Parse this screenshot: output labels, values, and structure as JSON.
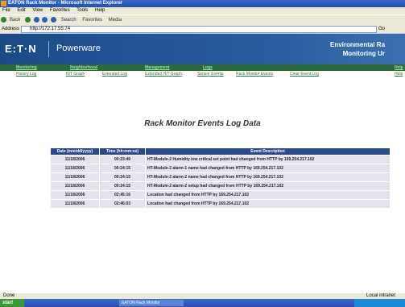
{
  "window": {
    "title": "EATON Rack Monitor - Microsoft Internet Explorer"
  },
  "menu": [
    "File",
    "Edit",
    "View",
    "Favorites",
    "Tools",
    "Help"
  ],
  "toolbar": {
    "back": "Back",
    "search": "Search",
    "favorites": "Favorites",
    "media": "Media"
  },
  "address": {
    "label": "Address",
    "url": "http://172.17.55.74",
    "go": "Go"
  },
  "banner": {
    "logo": "E:T·N",
    "brand": "Powerware",
    "title_line1": "Environmental Ra",
    "title_line2": "Monitoring Ur"
  },
  "nav_primary": [
    {
      "label": "Monitoring"
    },
    {
      "label": "Neighborhood"
    },
    {
      "label": "Management"
    },
    {
      "label": "Logs"
    },
    {
      "label": "Help"
    }
  ],
  "nav_secondary": [
    {
      "label": "History Log"
    },
    {
      "label": "H/T Graph"
    },
    {
      "label": "Extended Log"
    },
    {
      "label": "Extended H/T Graph"
    },
    {
      "label": "Sensor Events"
    },
    {
      "label": "Rack Monitor Events"
    },
    {
      "label": "Clear Event Log"
    },
    {
      "label": "Help"
    }
  ],
  "page_title": "Rack Monitor Events Log Data",
  "table": {
    "headers": [
      "Date (mm/dd/yyyy)",
      "Time (hh:mm:ss)",
      "Event Description"
    ],
    "rows": [
      [
        "11/18/2006",
        "00:23:49",
        "HT-Module-2 Humidity low critical set point had changed from HTTP by 169.254.217.102"
      ],
      [
        "11/18/2006",
        "00:24:15",
        "HT-Module-2 alarm-1 name had changed from HTTP by 169.254.217.102"
      ],
      [
        "11/18/2006",
        "00:24:15",
        "HT-Module-2 alarm-2 name had changed from HTTP by 169.254.217.102"
      ],
      [
        "11/18/2006",
        "00:24:15",
        "HT-Module-2 alarm-2 setup had changed from HTTP by 169.254.217.102"
      ],
      [
        "11/18/2006",
        "02:45:16",
        "Location had changed from HTTP by 169.254.217.102"
      ],
      [
        "11/18/2006",
        "02:46:03",
        "Location had changed from HTTP by 169.254.217.102"
      ]
    ]
  },
  "status": {
    "left": "Done",
    "right": "Local intranet"
  },
  "taskbar": {
    "start": "start",
    "task": "EATON Rack Monitor"
  }
}
